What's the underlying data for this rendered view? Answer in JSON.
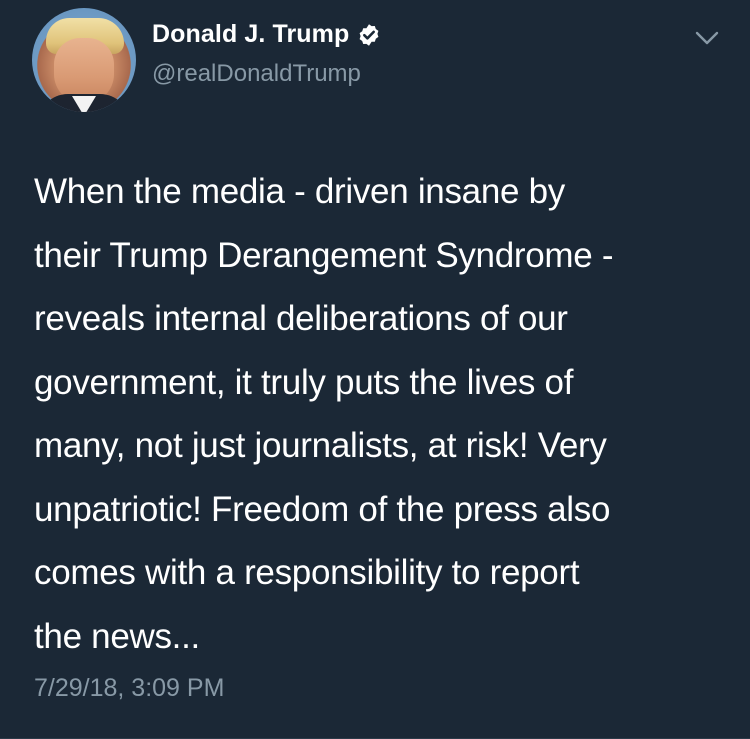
{
  "tweet": {
    "author": {
      "name": "Donald J. Trump",
      "handle": "@realDonaldTrump",
      "verified": true,
      "avatar_icon": "profile-photo"
    },
    "text": "When the media - driven insane by\ntheir Trump Derangement Syndrome -\nreveals internal deliberations of our\ngovernment, it  truly puts the lives of\nmany, not just journalists, at risk! Very\nunpatriotic! Freedom of the press also\ncomes with a responsibility to report\nthe news...",
    "timestamp": "7/29/18, 3:09 PM",
    "menu_icon": "chevron-down-icon"
  },
  "colors": {
    "background": "#1b2836",
    "text_primary": "#ffffff",
    "text_secondary": "#8899a6",
    "verified_badge": "#ffffff"
  }
}
